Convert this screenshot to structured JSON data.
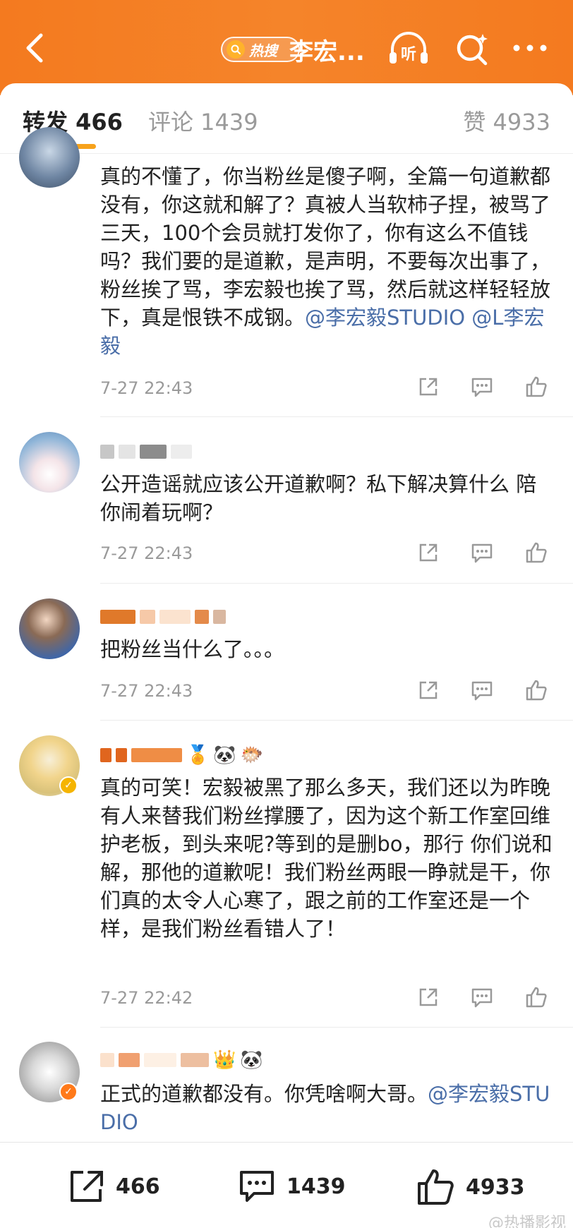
{
  "header": {
    "hot_badge": "热搜",
    "title": "李宏...",
    "listen_label": "听"
  },
  "tabs": {
    "repost": "转发 466",
    "comment": "评论 1439",
    "like": "赞 4933"
  },
  "comments": [
    {
      "text": "真的不懂了，你当粉丝是傻子啊，全篇一句道歉都没有，你这就和解了？真被人当软柿子捏，被骂了三天，100个会员就打发你了，你有这么不值钱吗？我们要的是道歉，是声明，不要每次出事了，粉丝挨了骂，李宏毅也挨了骂，然后就这样轻轻放下，真是恨铁不成钢。",
      "mentions": "@李宏毅STUDIO @L李宏毅",
      "time": "7-27 22:43"
    },
    {
      "text": "公开造谣就应该公开道歉啊？私下解决算什么 陪你闹着玩啊？",
      "time": "7-27 22:43"
    },
    {
      "text": "把粉丝当什么了。。。",
      "time": "7-27 22:43"
    },
    {
      "text": "真的可笑！宏毅被黑了那么多天，我们还以为昨晚有人来替我们粉丝撑腰了，因为这个新工作室回维护老板，到头来呢?等到的是删bo，那行 你们说和解，那他的道歉呢！我们粉丝两眼一睁就是干，你们真的太令人心寒了，跟之前的工作室还是一个样，是我们粉丝看错人了！",
      "time": "7-27 22:42"
    },
    {
      "text": "正式的道歉都没有。你凭啥啊大哥。",
      "mentions": "@李宏毅STUDIO"
    }
  ],
  "bottom_bar": {
    "repost_count": "466",
    "comment_count": "1439",
    "like_count": "4933"
  },
  "watermark": "@热播影视",
  "colors": {
    "header": "#f47a1f",
    "accent_underline": "#f7a21b",
    "mention": "#4a6ea8"
  }
}
